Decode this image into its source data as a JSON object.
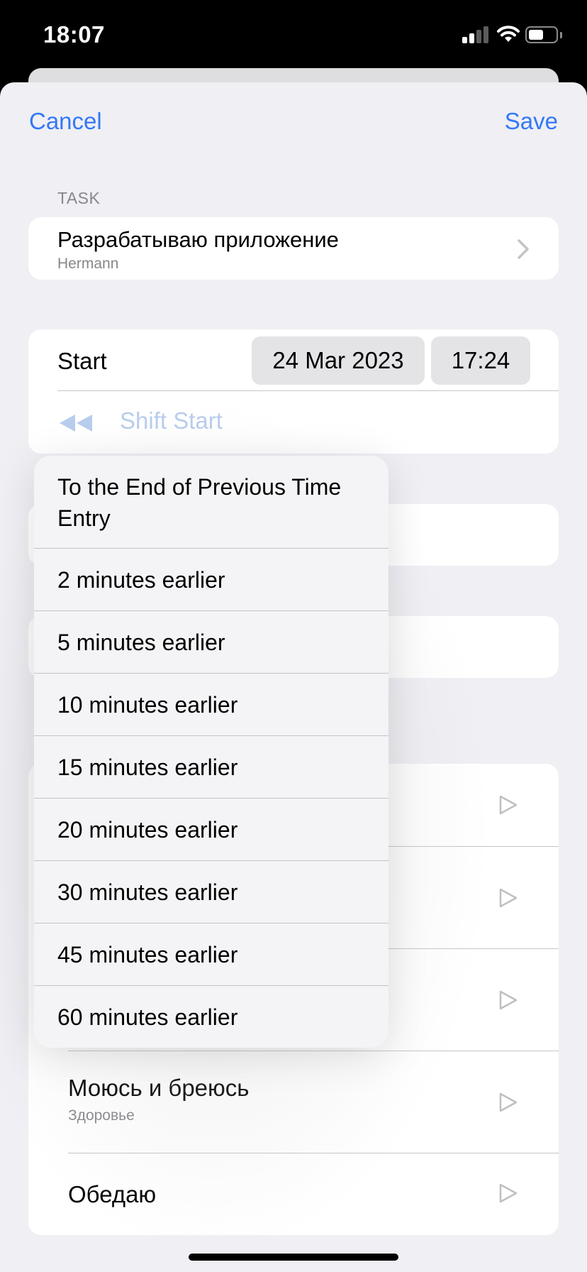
{
  "status_bar": {
    "time": "18:07"
  },
  "nav": {
    "cancel": "Cancel",
    "save": "Save"
  },
  "task_section": {
    "header": "TASK",
    "title": "Разрабатываю приложение",
    "subtitle": "Hermann"
  },
  "start_section": {
    "label": "Start",
    "date": "24 Mar 2023",
    "time": "17:24",
    "shift_label": "Shift Start"
  },
  "shift_menu": {
    "items": [
      "To the End of Previous Time Entry",
      "2 minutes earlier",
      "5 minutes earlier",
      "10 minutes earlier",
      "15 minutes earlier",
      "20 minutes earlier",
      "30 minutes earlier",
      "45 minutes earlier",
      "60 minutes earlier"
    ]
  },
  "task_list": {
    "items": [
      {
        "title": "Моюсь и бреюсь",
        "subtitle": "Здоровье"
      },
      {
        "title": "Обедаю",
        "subtitle": ""
      }
    ]
  },
  "colors": {
    "accent": "#3478f6",
    "sheet_background": "#efeff4",
    "disabled_accent": "#b8ccee"
  }
}
